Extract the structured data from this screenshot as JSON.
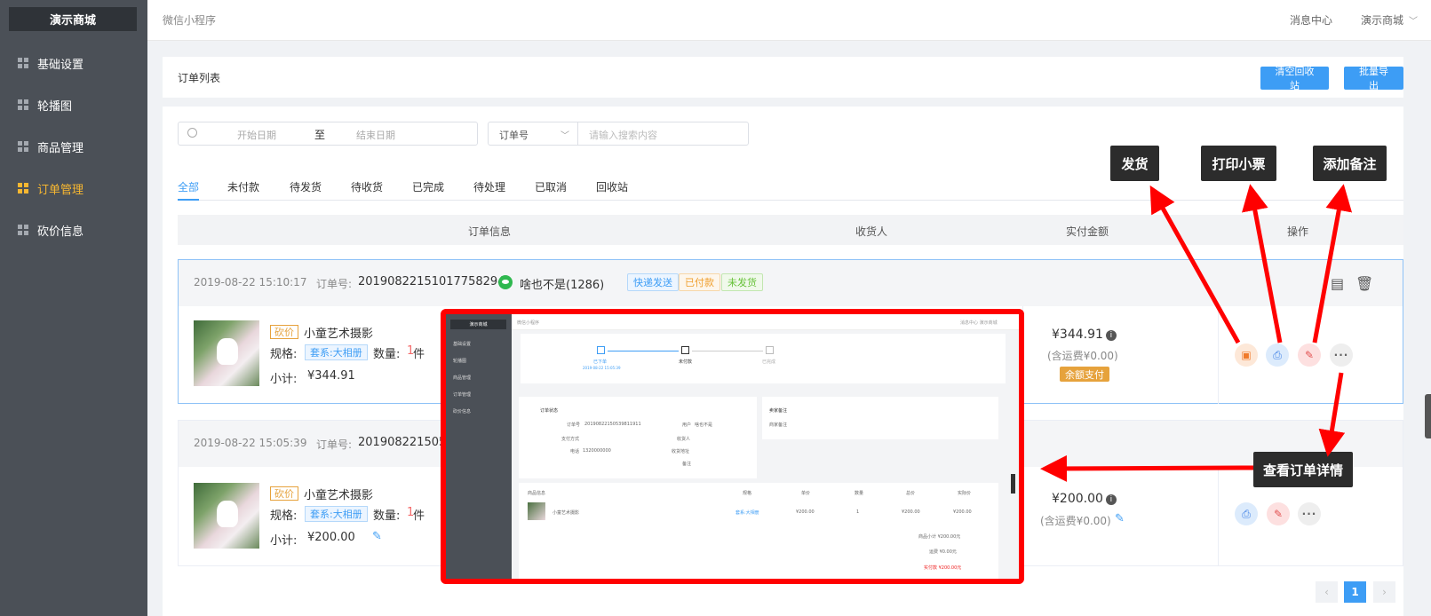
{
  "sidebar": {
    "brand": "演示商城",
    "items": [
      {
        "label": "基础设置",
        "active": false
      },
      {
        "label": "轮播图",
        "active": false
      },
      {
        "label": "商品管理",
        "active": false
      },
      {
        "label": "订单管理",
        "active": true
      },
      {
        "label": "砍价信息",
        "active": false
      }
    ]
  },
  "topbar": {
    "breadcrumb": "微信小程序",
    "message_center": "消息中心",
    "user": "演示商城"
  },
  "page": {
    "title": "订单列表",
    "clear_recycle_button": "清空回收站",
    "export_button": "批量导出"
  },
  "filters": {
    "start_placeholder": "开始日期",
    "range_sep": "至",
    "end_placeholder": "结束日期",
    "search_field": "订单号",
    "search_placeholder": "请输入搜索内容"
  },
  "tabs": [
    "全部",
    "未付款",
    "待发货",
    "待收货",
    "已完成",
    "待处理",
    "已取消",
    "回收站"
  ],
  "table_headers": {
    "order_info": "订单信息",
    "receiver": "收货人",
    "amount": "实付金额",
    "actions": "操作"
  },
  "labels": {
    "order_no": "订单号:",
    "spec": "规格:",
    "qty": "数量:",
    "unit": "件",
    "subtotal": "小计:",
    "kanjia": "砍价"
  },
  "orders": [
    {
      "time": "2019-08-22 15:10:17",
      "order_no": "20190822151017758294",
      "buyer": "啥也不是(1286)",
      "tags": [
        "快递发送",
        "已付款",
        "未发货"
      ],
      "product": "小童艺术摄影",
      "spec": "套系:大相册",
      "qty": "1",
      "subtotal": "¥344.91",
      "amount": "¥344.91",
      "fee": "(含运费¥0.00)",
      "pay_method": "余额支付"
    },
    {
      "time": "2019-08-22 15:05:39",
      "order_no": "20190822150539",
      "product": "小童艺术摄影",
      "spec": "套系:大相册",
      "qty": "1",
      "subtotal": "¥200.00",
      "amount": "¥200.00",
      "fee": "(含运费¥0.00)"
    }
  ],
  "pagination": {
    "prev": "‹",
    "current": "1",
    "next": "›"
  },
  "preview": {
    "brand": "演示商城",
    "breadcrumb": "微信小程序",
    "top_right": "消息中心  演示商城",
    "nav": [
      "基础设置",
      "轮播图",
      "商品管理",
      "订单管理",
      "砍价信息"
    ],
    "steps": [
      "已下单",
      "未付款",
      "已完成"
    ],
    "step_date": "2019-08-22 15:05:39",
    "status_title": "订单状态",
    "remark_title": "卖家备注",
    "remark_label": "商家备注",
    "fields": {
      "order_no_label": "订单号",
      "order_no": "20190822150539811911",
      "user_label": "用户",
      "user": "啥也不是",
      "pay_label": "支付方式",
      "receiver_label": "收货人",
      "phone_label": "电话",
      "phone": "1320000000",
      "addr_label": "收货地址",
      "remark_label": "备注"
    },
    "table_headers": [
      "商品信息",
      "规格",
      "单价",
      "数量",
      "总价",
      "实际价"
    ],
    "row": {
      "name": "小童艺术摄影",
      "spec": "套系:大相册",
      "price": "¥200.00",
      "qty": "1",
      "total": "¥200.00",
      "real": "¥200.00"
    },
    "goods_total": "商品小计  ¥200.00元",
    "shipping": "运费  ¥0.00元",
    "paid": "实付款  ¥200.00元"
  },
  "callouts": {
    "ship": "发货",
    "print": "打印小票",
    "note": "添加备注",
    "detail": "查看订单详情"
  },
  "colors": {
    "accent": "#3d9df5",
    "sidebar": "#4b5057",
    "annotation_red": "#ff0000",
    "active_nav": "#f7b731"
  }
}
